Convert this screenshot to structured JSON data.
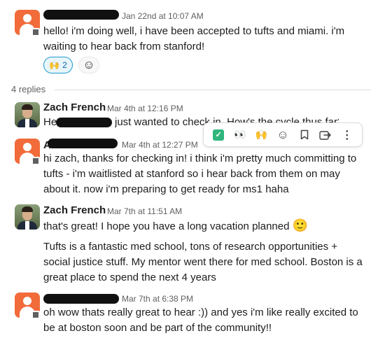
{
  "messages": [
    {
      "time": "Jan 22nd at 10:07 AM",
      "text": "hello! i'm doing well, i have been accepted to tufts and miami. i'm waiting to hear back from stanford!",
      "reaction_emoji": "🙌",
      "reaction_count": "2"
    },
    {
      "name": "Zach French",
      "time": "Mar 4th at 12:16 PM",
      "text_start": "He",
      "text_rest": "just wanted to check in. How's the cycle thus far?"
    },
    {
      "name_prefix": "Abi",
      "time": "Mar 4th at 12:27 PM",
      "text": "hi zach, thanks for checking in! i think i'm pretty much committing to tufts - i'm waitlisted at stanford so i hear back from them on may about it. now i'm preparing to get ready for ms1 haha"
    },
    {
      "name": "Zach French",
      "time": "Mar 7th at 11:51 AM",
      "text1": "that's great! I hope you have a long vacation planned",
      "emoji": "🙂",
      "text2": "Tufts is a fantastic med school, tons of research opportunities + social justice stuff. My mentor went there for med school. Boston is a great place to spend the next 4 years"
    },
    {
      "time": "Mar 7th at 6:38 PM",
      "text": "oh wow thats really great to hear :)) and yes i'm like really excited to be at boston soon and be part of the community!!"
    }
  ],
  "replies_label": "4 replies",
  "toolbar": {
    "check_icon": "✓",
    "eyes": "👀",
    "raised_hands": "🙌",
    "add_reaction": "☺",
    "bookmark": "bookmark",
    "more": "⋮"
  }
}
